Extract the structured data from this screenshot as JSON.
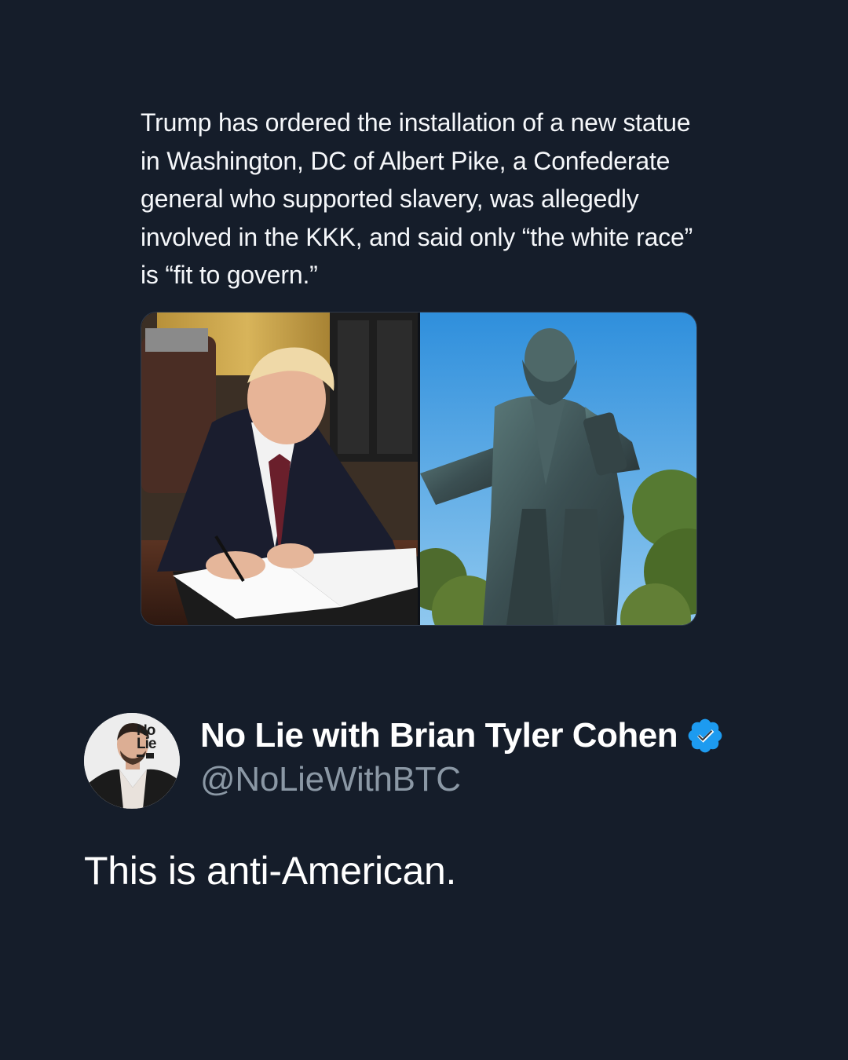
{
  "quoted_post": {
    "text": "Trump has ordered the installation of a new statue in Washington, DC of Albert Pike, a Confederate general who supported slavery, was allegedly involved in the KKK, and said only “the white race” is “fit to govern.”"
  },
  "media": {
    "left_image": "photo-man-signing-document",
    "right_image": "photo-bronze-statue"
  },
  "author": {
    "display_name": "No Lie with Brian Tyler Cohen",
    "handle": "@NoLieWithBTC",
    "avatar_logo_line1": "No",
    "avatar_logo_line2": "Lie",
    "verified": true,
    "verified_color": "#1d9bf0"
  },
  "post": {
    "text": "This is anti-American."
  },
  "colors": {
    "background": "#151d2a",
    "handle": "#8b98a5",
    "text": "#ffffff"
  }
}
